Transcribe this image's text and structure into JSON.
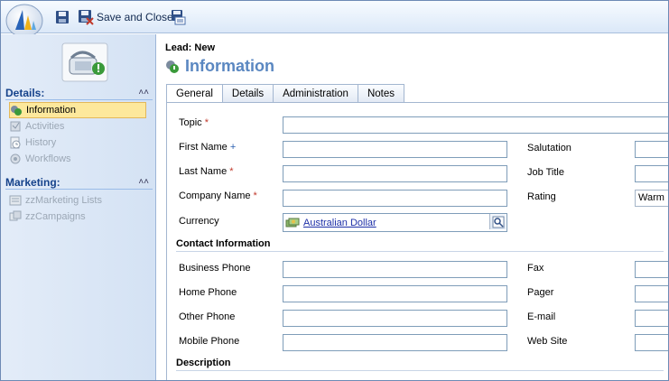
{
  "toolbar": {
    "save_icon": "save-icon",
    "save_close_label": "Save and Close",
    "save_print_icon": "save-print-icon"
  },
  "leftnav": {
    "details_header": "Details:",
    "details_items": [
      {
        "label": "Information",
        "icon": "information-icon",
        "selected": true
      },
      {
        "label": "Activities",
        "icon": "activities-icon",
        "selected": false
      },
      {
        "label": "History",
        "icon": "history-icon",
        "selected": false
      },
      {
        "label": "Workflows",
        "icon": "workflows-icon",
        "selected": false
      }
    ],
    "marketing_header": "Marketing:",
    "marketing_items": [
      {
        "label": "zzMarketing Lists",
        "icon": "marketing-list-icon"
      },
      {
        "label": "zzCampaigns",
        "icon": "campaign-icon"
      }
    ]
  },
  "form": {
    "kind": "Lead: New",
    "title": "Information",
    "tabs": [
      {
        "label": "General",
        "active": true
      },
      {
        "label": "Details",
        "active": false
      },
      {
        "label": "Administration",
        "active": false
      },
      {
        "label": "Notes",
        "active": false
      }
    ],
    "fields": {
      "topic": {
        "label": "Topic",
        "value": ""
      },
      "first_name": {
        "label": "First Name",
        "value": ""
      },
      "last_name": {
        "label": "Last Name",
        "value": ""
      },
      "company_name": {
        "label": "Company Name",
        "value": ""
      },
      "currency": {
        "label": "Currency",
        "value": "Australian Dollar"
      },
      "salutation": {
        "label": "Salutation",
        "value": ""
      },
      "job_title": {
        "label": "Job Title",
        "value": ""
      },
      "rating": {
        "label": "Rating",
        "value": "Warm"
      }
    },
    "required_marker": "*",
    "recommended_marker": "+",
    "contact_section": "Contact Information",
    "contact_fields": {
      "business_phone": {
        "label": "Business Phone",
        "value": ""
      },
      "home_phone": {
        "label": "Home Phone",
        "value": ""
      },
      "other_phone": {
        "label": "Other Phone",
        "value": ""
      },
      "mobile_phone": {
        "label": "Mobile Phone",
        "value": ""
      },
      "fax": {
        "label": "Fax",
        "value": ""
      },
      "pager": {
        "label": "Pager",
        "value": ""
      },
      "email": {
        "label": "E-mail",
        "value": ""
      },
      "web_site": {
        "label": "Web Site",
        "value": ""
      }
    },
    "description_section": "Description"
  },
  "colors": {
    "title": "#5a87c1",
    "nav_header": "#15428b",
    "selected_bg": "#fde89c",
    "required": "#c0392b",
    "recommended": "#2a5fb0",
    "link": "#1d2fa8"
  }
}
